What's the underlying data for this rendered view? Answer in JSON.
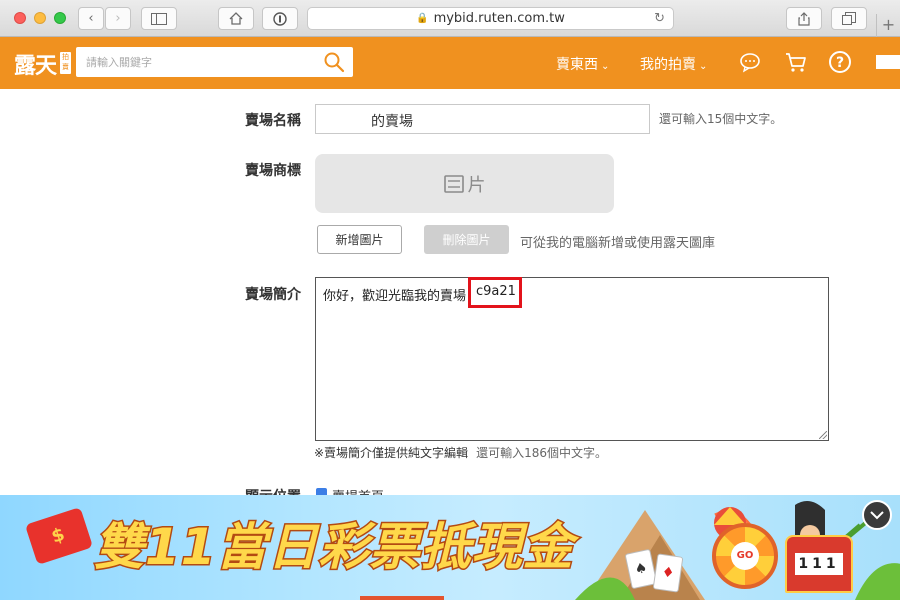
{
  "browser": {
    "url": "mybid.ruten.com.tw"
  },
  "header": {
    "logo": "露天",
    "logo_tag": "拍賣",
    "search_placeholder": "請輸入關鍵字",
    "nav_sell": "賣東西",
    "nav_my_auction": "我的拍賣",
    "accent": "#f0911f"
  },
  "form": {
    "store_name_label": "賣場名稱",
    "store_name_value": "的賣場",
    "store_name_hint": "還可輸入15個中文字。",
    "logo_label": "賣場商標",
    "logo_placeholder": "片",
    "add_image_button": "新增圖片",
    "delete_image_button": "刪除圖片",
    "image_hint": "可從我的電腦新增或使用露天圖庫",
    "intro_label": "賣場簡介",
    "intro_value": "你好，歡迎光臨我的賣場",
    "intro_highlight": "c9a21",
    "intro_note": "※賣場簡介僅提供純文字編輯",
    "intro_hint": "還可輸入186個中文字。",
    "display_label": "顯示位置",
    "display_option": "賣場首頁"
  },
  "banner": {
    "headline": "雙11當日彩票抵現金",
    "wheel_text": "GO",
    "slot_digits": "111",
    "highlight_color": "#e3131b"
  }
}
